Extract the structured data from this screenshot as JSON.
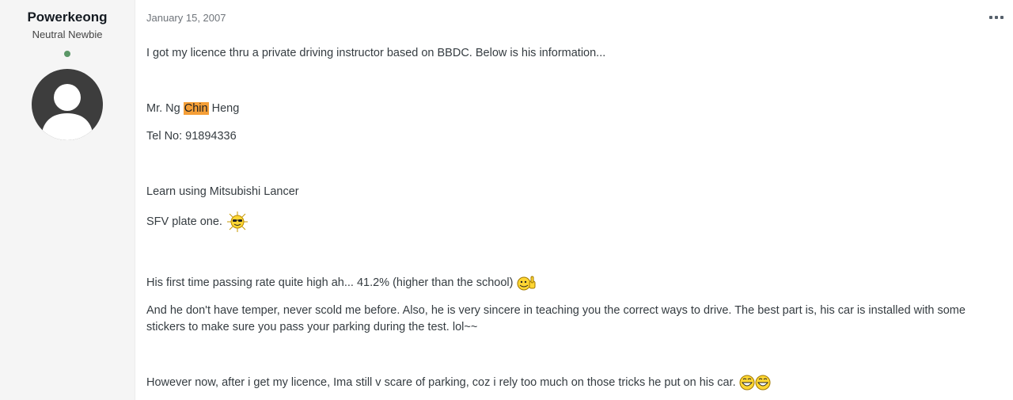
{
  "author": {
    "name": "Powerkeong",
    "rank": "Neutral Newbie",
    "online_status_color": "#5b9767",
    "avatar": "default-user-avatar"
  },
  "post": {
    "date": "January 15, 2007",
    "menu_icon": "ellipsis-icon",
    "line1": "I got my licence thru a private driving instructor based on BBDC. Below is his information...",
    "name_prefix": "Mr. Ng ",
    "name_highlight": "Chin",
    "name_suffix": " Heng",
    "highlight_color": "#f59f37",
    "tel": "Tel No: 91894336",
    "car": "Learn using Mitsubishi Lancer",
    "plate": "SFV plate one.",
    "plate_emoticon": "cool-sun-emoticon",
    "passing": "His first time passing rate quite high ah... 41.2% (higher than the school)",
    "passing_emoticon": "thumbs-up-emoticon",
    "temper": "And he don't have temper, never scold me before. Also, he is very sincere in teaching you the correct ways to drive. The best part is, his car is installed with some stickers to make sure you pass your parking during the test. lol~~",
    "however": "However now, after i get my licence, Ima still v scare of parking, coz i rely too much on those tricks he put on his car.",
    "however_emoticons": [
      "grin-emoticon",
      "grin-emoticon"
    ]
  }
}
